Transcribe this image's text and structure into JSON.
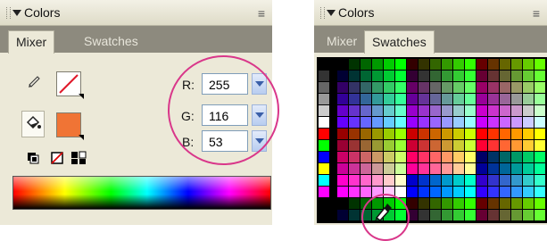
{
  "panels": {
    "mixer_panel": {
      "title": "Colors",
      "tabs": [
        "Mixer",
        "Swatches"
      ],
      "active_tab": "Mixer",
      "rgb": [
        {
          "label": "R:",
          "value": "255"
        },
        {
          "label": "G:",
          "value": "116"
        },
        {
          "label": "B:",
          "value": "53"
        }
      ],
      "fill_color": "#f07435",
      "stroke_state": "none"
    },
    "swatches_panel": {
      "title": "Colors",
      "tabs": [
        "Mixer",
        "Swatches"
      ],
      "active_tab": "Swatches"
    }
  },
  "icons": [
    "panel-grip-icon",
    "collapse-triangle-icon",
    "panel-menu-icon",
    "pencil-icon",
    "paint-bucket-icon",
    "black-white-icon",
    "no-color-icon",
    "swap-colors-icon",
    "eyedropper-icon"
  ],
  "highlight_color": "#d9378a"
}
